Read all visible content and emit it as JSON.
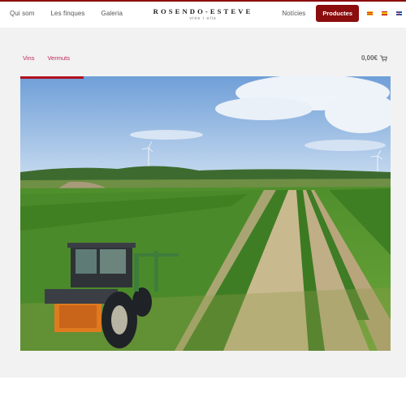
{
  "header": {
    "nav_left": [
      "Qui som",
      "Les finques",
      "Galeria"
    ],
    "brand_name": "ROSENDO-ESTEVE",
    "brand_sub": "vins i olis",
    "nav_noticies": "Notícies",
    "productes_button": "Productes",
    "languages": [
      "ca",
      "es",
      "en"
    ]
  },
  "subnav": {
    "items": [
      "Vins",
      "Vermuts"
    ]
  },
  "cart": {
    "total": "0,00€",
    "icon": "cart-icon"
  },
  "hero": {
    "slider_progress_percent": 17
  },
  "colors": {
    "brand": "#8b0d0d",
    "subnav_link": "#c2265b",
    "background": "#f2f2f2"
  }
}
